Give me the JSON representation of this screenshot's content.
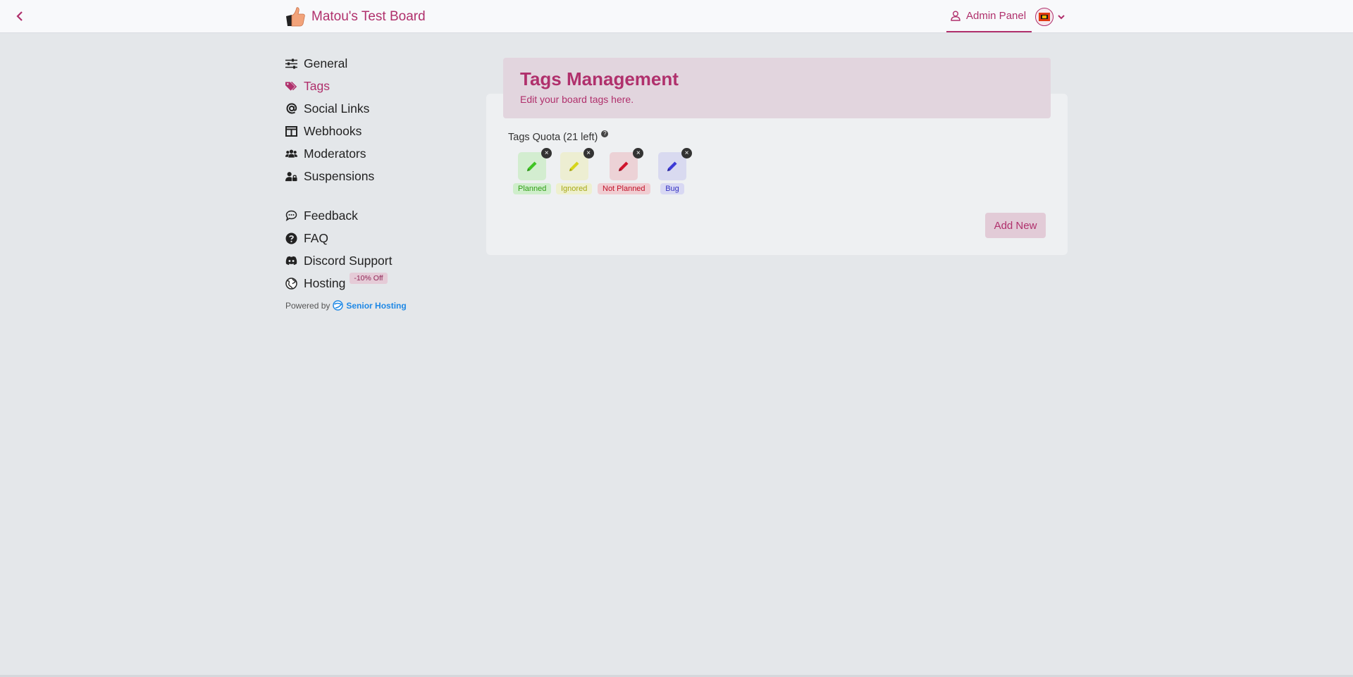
{
  "topbar": {
    "board_name": "Matou's Test Board",
    "admin_label": "Admin Panel",
    "icons": {
      "back": "chevron-left-icon",
      "logo": "thumbs-up-icon",
      "admin": "user-icon",
      "menu": "chevron-down-icon"
    }
  },
  "sidebar": {
    "items": [
      {
        "label": "General",
        "icon": "sliders-icon",
        "active": false
      },
      {
        "label": "Tags",
        "icon": "tags-icon",
        "active": true
      },
      {
        "label": "Social Links",
        "icon": "at-icon",
        "active": false
      },
      {
        "label": "Webhooks",
        "icon": "webhook-icon",
        "active": false
      },
      {
        "label": "Moderators",
        "icon": "users-icon",
        "active": false
      },
      {
        "label": "Suspensions",
        "icon": "user-lock-icon",
        "active": false
      }
    ],
    "links": [
      {
        "label": "Feedback",
        "icon": "comment-icon"
      },
      {
        "label": "FAQ",
        "icon": "question-circle-icon"
      },
      {
        "label": "Discord Support",
        "icon": "discord-icon"
      },
      {
        "label": "Hosting",
        "icon": "globe-icon",
        "badge": "-10% Off"
      }
    ],
    "powered_by": "Powered by",
    "powered_link": "Senior Hosting"
  },
  "main": {
    "title": "Tags Management",
    "subtitle": "Edit your board tags here.",
    "quota_label": "Tags Quota (21 left)",
    "tags": [
      {
        "name": "Planned",
        "color": "#3fc423",
        "bg": "#d3edd0",
        "label_bg": "#cfeecb"
      },
      {
        "name": "Ignored",
        "color": "#c9c81b",
        "bg": "#edeed2",
        "label_bg": "#eef0cf"
      },
      {
        "name": "Not Planned",
        "color": "#d0142d",
        "bg": "#ecd2d6",
        "label_bg": "#f0cdd2"
      },
      {
        "name": "Bug",
        "color": "#3d3bd6",
        "bg": "#d9daf0",
        "label_bg": "#d8d8f3"
      }
    ],
    "add_button": "Add New"
  },
  "colors": {
    "accent": "#b0306c",
    "background": "#e4e7ea"
  }
}
